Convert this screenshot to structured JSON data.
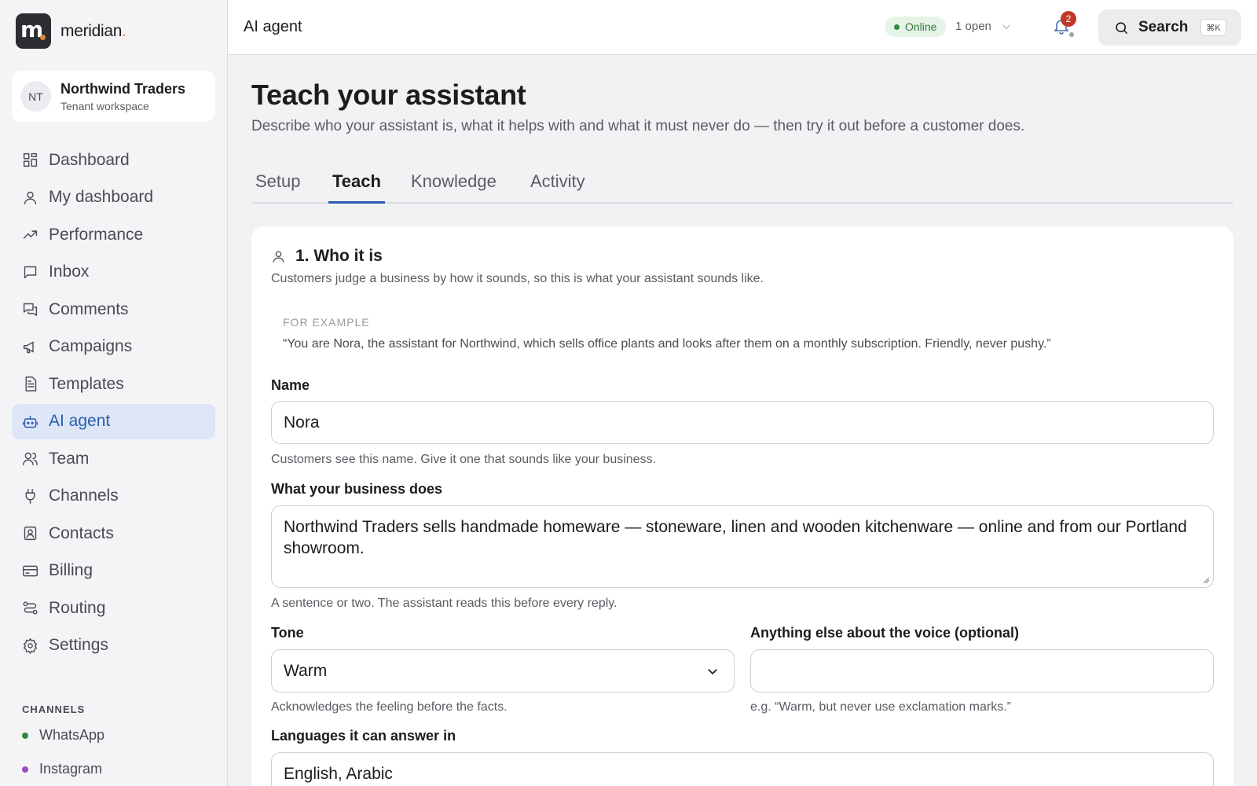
{
  "brand": {
    "logo_letter": "m",
    "name": "meridian",
    "name_accent": "."
  },
  "workspace": {
    "initials": "NT",
    "name": "Northwind Traders",
    "subtitle": "Tenant workspace"
  },
  "nav": [
    {
      "label": "Dashboard",
      "icon": "grid-icon"
    },
    {
      "label": "My dashboard",
      "icon": "user-icon"
    },
    {
      "label": "Performance",
      "icon": "trend-icon"
    },
    {
      "label": "Inbox",
      "icon": "message-icon"
    },
    {
      "label": "Comments",
      "icon": "comments-icon"
    },
    {
      "label": "Campaigns",
      "icon": "megaphone-icon"
    },
    {
      "label": "Templates",
      "icon": "file-icon"
    },
    {
      "label": "AI agent",
      "icon": "bot-icon",
      "active": true
    },
    {
      "label": "Team",
      "icon": "users-icon"
    },
    {
      "label": "Channels",
      "icon": "plug-icon"
    },
    {
      "label": "Contacts",
      "icon": "contact-icon"
    },
    {
      "label": "Billing",
      "icon": "card-icon"
    },
    {
      "label": "Routing",
      "icon": "route-icon"
    },
    {
      "label": "Settings",
      "icon": "gear-icon"
    }
  ],
  "channels": {
    "title": "CHANNELS",
    "items": [
      {
        "label": "WhatsApp",
        "color": "#2f8a3e"
      },
      {
        "label": "Instagram",
        "color": "#9b4fc0"
      }
    ]
  },
  "topbar": {
    "title": "AI agent",
    "status": "Online",
    "open_count": "1 open",
    "notifications": "2",
    "search_label": "Search",
    "search_shortcut": "⌘K"
  },
  "page": {
    "title": "Teach your assistant",
    "subtitle": "Describe who your assistant is, what it helps with and what it must never do — then try it out before a customer does."
  },
  "tabs": [
    "Setup",
    "Teach",
    "Knowledge",
    "Activity"
  ],
  "active_tab": "Teach",
  "section": {
    "title": "1. Who it is",
    "subtitle": "Customers judge a business by how it sounds, so this is what your assistant sounds like.",
    "example_label": "FOR EXAMPLE",
    "example_text": "“You are Nora, the assistant for Northwind, which sells office plants and looks after them on a monthly subscription. Friendly, never pushy.”"
  },
  "fields": {
    "name": {
      "label": "Name",
      "value": "Nora",
      "hint": "Customers see this name. Give it one that sounds like your business."
    },
    "business": {
      "label": "What your business does",
      "value": "Northwind Traders sells handmade homeware — stoneware, linen and wooden kitchenware — online and from our Portland showroom.",
      "hint": "A sentence or two. The assistant reads this before every reply."
    },
    "tone": {
      "label": "Tone",
      "value": "Warm",
      "hint": "Acknowledges the feeling before the facts."
    },
    "voice": {
      "label": "Anything else about the voice (optional)",
      "value": "",
      "hint": "e.g. “Warm, but never use exclamation marks.”"
    },
    "languages": {
      "label": "Languages it can answer in",
      "value": "English, Arabic"
    }
  },
  "colors": {
    "accent": "#2a5db0",
    "active_nav_bg": "#dde6f7",
    "online": "#2f8a3e",
    "badge": "#c0392b"
  }
}
